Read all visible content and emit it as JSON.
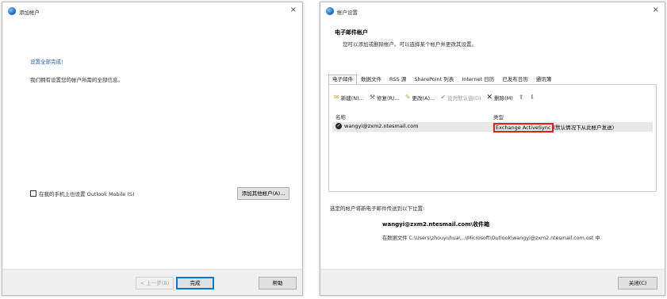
{
  "dialog1": {
    "title": "添加帐户",
    "close": "×",
    "done_link": "设置全部完成!",
    "message": "我们拥有设置您的帐户所需的全部信息。",
    "mobile_checkbox_label": "在我的手机上也设置 Outlook Mobile (S)",
    "add_another_button": "添加其他帐户(A)...",
    "back_button": "< 上一步(B)",
    "finish_button": "完成",
    "help_button": "帮助"
  },
  "dialog2": {
    "title": "帐户设置",
    "close": "×",
    "header_title": "电子邮件帐户",
    "header_desc": "您可以添加或删除帐户。可以选择某个帐户并更改其设置。",
    "tabs": [
      "电子邮件",
      "数据文件",
      "RSS 源",
      "SharePoint 列表",
      "Internet 日历",
      "已发布日历",
      "通讯簿"
    ],
    "toolbar": {
      "new": "新建(N)...",
      "repair": "修复(R)...",
      "change": "更改(A)...",
      "set_default": "设为默认值(D)",
      "remove": "删除(M)",
      "up": "⬆",
      "down": "⬇"
    },
    "columns": {
      "name": "名称",
      "type": "类型"
    },
    "account": {
      "email": "wangyi@zxm2.ntesmail.com",
      "type": "Exchange ActiveSync",
      "type_suffix": "(默认情况下从此帐户发送)"
    },
    "deliver_label": "选定的帐户将新电子邮件传送到以下位置:",
    "deliver_account": "wangyi@zxm2.ntesmail.com\\收件箱",
    "deliver_path": "在数据文件 C:\\Users\\zhouyuhua\\...\\Microsoft\\Outlook\\wangyi@zxm2.ntesmail.com.ost 中",
    "close_button": "关闭(C)"
  },
  "colors": {
    "accent": "#0078d7",
    "highlight": "#e02020",
    "link": "#2b5fa8"
  },
  "icons": [
    "outlook-icon",
    "new-account-icon",
    "repair-icon",
    "change-icon",
    "default-check-icon",
    "remove-x-icon",
    "move-up-icon",
    "move-down-icon",
    "checkmark-circle-icon"
  ]
}
